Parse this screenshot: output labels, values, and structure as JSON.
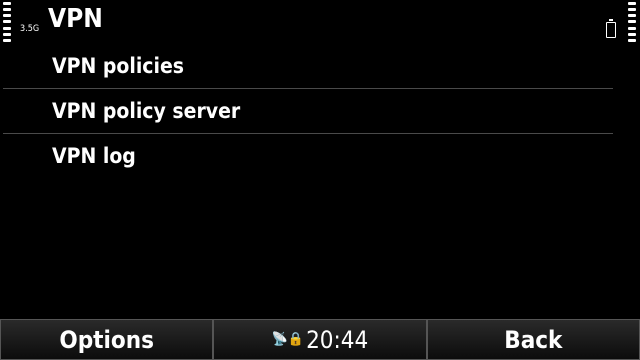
{
  "header": {
    "title": "VPN",
    "network_type": "3.5G",
    "signal_icon": "signal-strength-icon",
    "battery_icon": "battery-icon"
  },
  "list": {
    "items": [
      {
        "label": "VPN policies"
      },
      {
        "label": "VPN policy server"
      },
      {
        "label": "VPN log"
      }
    ]
  },
  "softkeys": {
    "left": "Options",
    "right": "Back",
    "clock": "20:44",
    "clock_icons": "📡🔒"
  }
}
